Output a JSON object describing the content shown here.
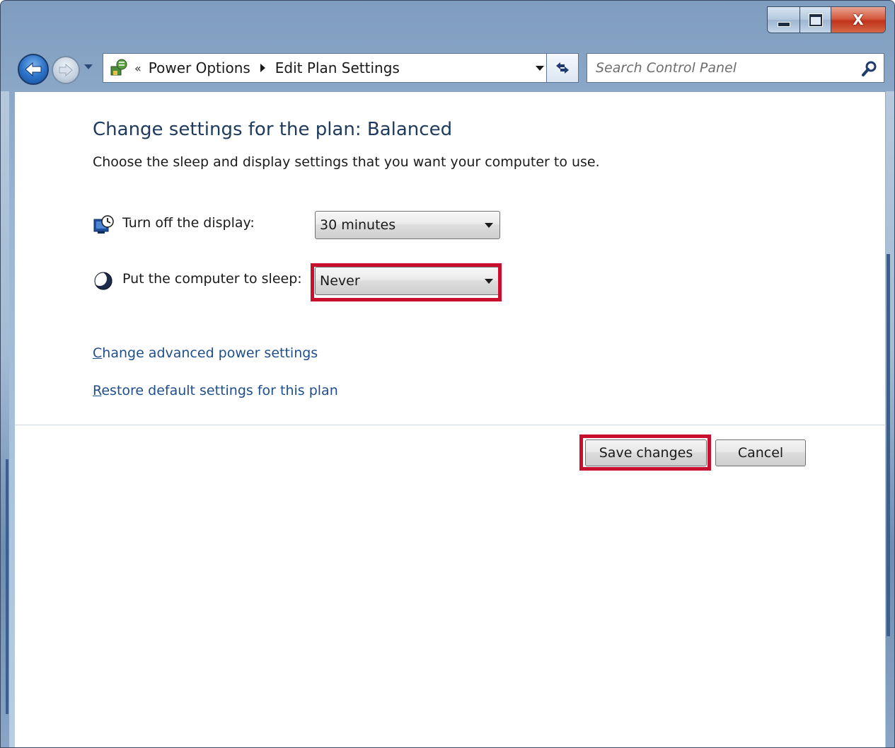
{
  "window": {
    "caption": {
      "minimize_icon": "minimize-icon",
      "maximize_icon": "maximize-icon",
      "close_label": "X"
    }
  },
  "nav": {
    "back_icon": "back-arrow-icon",
    "forward_icon": "forward-arrow-icon",
    "address_icon": "control-panel-icon",
    "overflow_chevron": "«",
    "breadcrumbs": [
      "Power Options",
      "Edit Plan Settings"
    ],
    "refresh_icon": "refresh-icon",
    "search_placeholder": "Search Control Panel",
    "search_icon": "search-icon"
  },
  "page": {
    "title": "Change settings for the plan: Balanced",
    "subtitle": "Choose the sleep and display settings that you want your computer to use.",
    "settings": [
      {
        "label": "Turn off the display:",
        "value": "30 minutes",
        "icon": "display-clock-icon"
      },
      {
        "label": "Put the computer to sleep:",
        "value": "Never",
        "icon": "moon-icon",
        "highlighted": true
      }
    ],
    "links": [
      {
        "accesskey": "C",
        "rest": "hange advanced power settings"
      },
      {
        "accesskey": "R",
        "rest": "estore default settings for this plan"
      }
    ],
    "buttons": {
      "save": "Save changes",
      "cancel": "Cancel"
    },
    "highlight_color": "#c8102e",
    "link_color": "#1e4e8c",
    "title_color": "#1e3a5f"
  }
}
